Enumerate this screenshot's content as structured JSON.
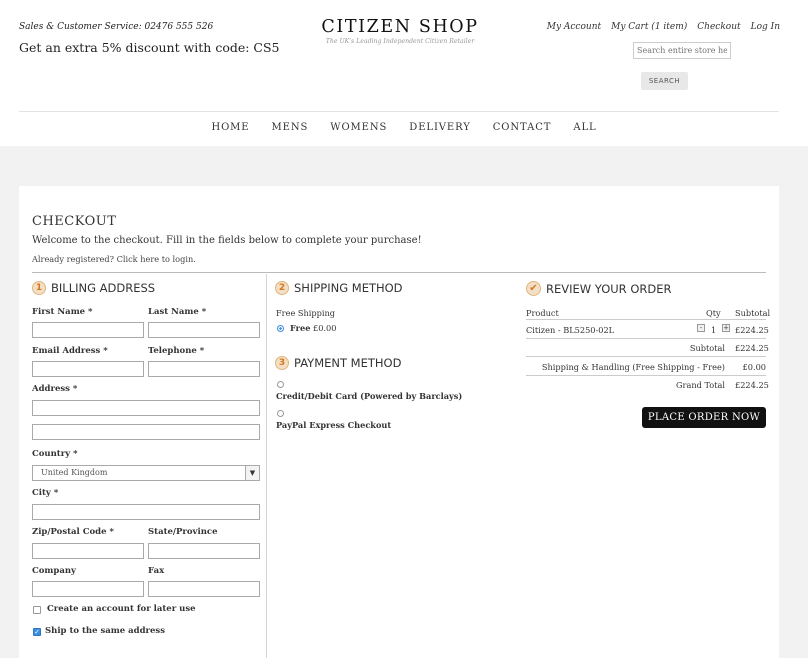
{
  "header": {
    "service": "Sales & Customer Service: 02476 555 526",
    "promo": "Get an extra 5% discount with code: CS5",
    "logo_title": "CITIZEN SHOP",
    "logo_tag": "The UK's Leading Independent Citizen Retailer",
    "links": [
      "My Account",
      "My Cart (1 item)",
      "Checkout",
      "Log In"
    ],
    "search_placeholder": "Search entire store here...",
    "search_button": "SEARCH"
  },
  "nav": [
    "HOME",
    "MENS",
    "WOMENS",
    "DELIVERY",
    "CONTACT",
    "ALL"
  ],
  "checkout": {
    "title": "CHECKOUT",
    "welcome": "Welcome to the checkout. Fill in the fields below to complete your purchase!",
    "already": "Already registered? Click here to login."
  },
  "billing": {
    "number": "1",
    "title": "BILLING ADDRESS",
    "first_name": "First Name *",
    "last_name": "Last Name *",
    "email": "Email Address *",
    "telephone": "Telephone *",
    "address": "Address *",
    "country": "Country *",
    "country_value": "United Kingdom",
    "city": "City *",
    "zip": "Zip/Postal Code *",
    "state": "State/Province",
    "company": "Company",
    "fax": "Fax",
    "create_account": "Create an account for later use",
    "ship_same": "Ship to the same address"
  },
  "shipping": {
    "number": "2",
    "title": "SHIPPING METHOD",
    "method_name": "Free Shipping",
    "option_label": "Free",
    "option_price": "£0.00"
  },
  "payment": {
    "number": "3",
    "title": "PAYMENT METHOD",
    "options": [
      "Credit/Debit Card (Powered by Barclays)",
      "PayPal Express Checkout"
    ]
  },
  "review": {
    "title": "REVIEW YOUR ORDER",
    "col_product": "Product",
    "col_qty": "Qty",
    "col_subtotal": "Subtotal",
    "product": "Citizen - BL5250-02L",
    "qty": "1",
    "line_subtotal": "£224.25",
    "subtotal_label": "Subtotal",
    "subtotal_value": "£224.25",
    "shipping_label": "Shipping & Handling (Free Shipping - Free)",
    "shipping_value": "£0.00",
    "grand_label": "Grand Total",
    "grand_value": "£224.25",
    "place_order": "PLACE ORDER NOW",
    "minus": "-",
    "plus": "+"
  },
  "colors": {
    "accent": "#d5771d",
    "button": "#111111",
    "radio": "#3b8fe0"
  }
}
